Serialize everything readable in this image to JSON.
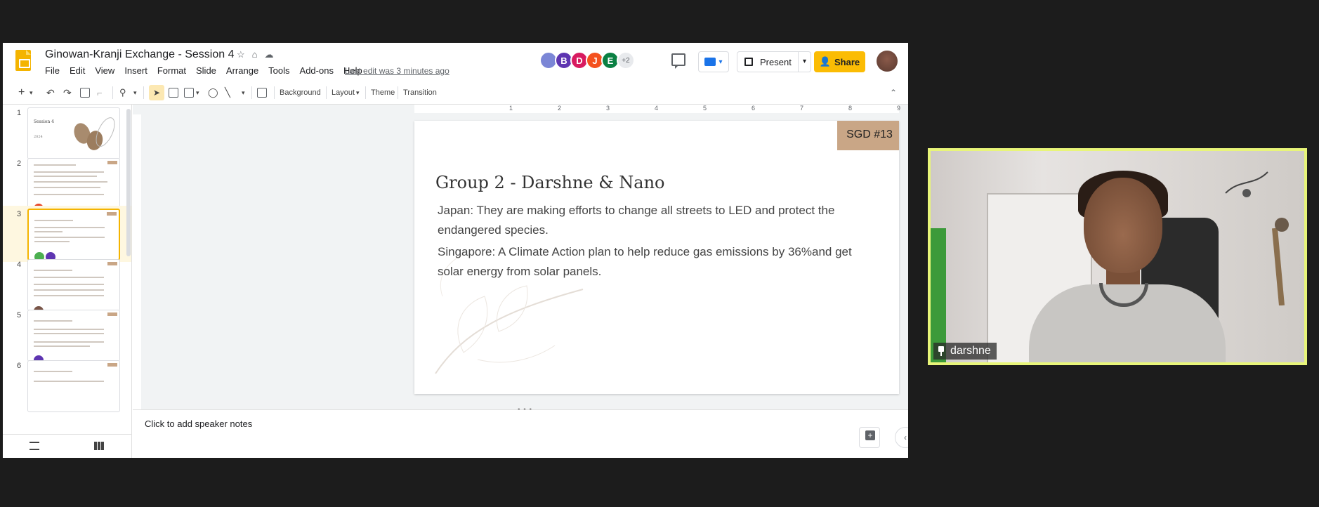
{
  "app": {
    "doc_title": "Ginowan-Kranji Exchange - Session 4",
    "menu": [
      "File",
      "Edit",
      "View",
      "Insert",
      "Format",
      "Slide",
      "Arrange",
      "Tools",
      "Add-ons",
      "Help"
    ],
    "last_edit": "Last edit was 3 minutes ago"
  },
  "collaborators": [
    {
      "initial": "",
      "color": "#7b86d6"
    },
    {
      "initial": "B",
      "color": "#5e35b1"
    },
    {
      "initial": "D",
      "color": "#d81b60"
    },
    {
      "initial": "J",
      "color": "#f4511e"
    },
    {
      "initial": "E",
      "color": "#0b8043"
    },
    {
      "initial": "+2",
      "color": "#e8eaed"
    }
  ],
  "header_buttons": {
    "present": "Present",
    "share": "Share"
  },
  "toolbar": {
    "background": "Background",
    "layout": "Layout",
    "theme": "Theme",
    "transition": "Transition"
  },
  "filmstrip": {
    "slides": [
      {
        "num": "1",
        "title": "Session 4",
        "sub": "2024"
      },
      {
        "num": "2"
      },
      {
        "num": "3"
      },
      {
        "num": "4"
      },
      {
        "num": "5"
      },
      {
        "num": "6"
      }
    ],
    "active": "3"
  },
  "ruler": [
    "1",
    "2",
    "3",
    "4",
    "5",
    "6",
    "7",
    "8",
    "9"
  ],
  "slide": {
    "tag": "SGD #13",
    "title": "Group 2 - Darshne & Nano",
    "p1": "Japan: They are making efforts to change all streets to LED and protect the endangered species.",
    "p2": "Singapore: A Climate Action plan to help reduce gas emissions by 36%and get solar energy from solar panels."
  },
  "notes": {
    "placeholder": "Click to add speaker notes"
  },
  "video": {
    "participant_name": "darshne",
    "border_color": "#e8f579"
  }
}
